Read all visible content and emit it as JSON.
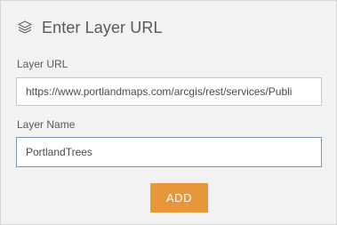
{
  "panel": {
    "title": "Enter Layer URL",
    "title_icon": "layers-icon"
  },
  "fields": {
    "url_label": "Layer URL",
    "url_value": "https://www.portlandmaps.com/arcgis/rest/services/Publi",
    "name_label": "Layer Name",
    "name_value": "PortlandTrees"
  },
  "actions": {
    "add_label": "ADD"
  },
  "colors": {
    "accent": "#e8963a",
    "panel_bg": "#f2f2f2",
    "focus_border": "#7b95b5"
  }
}
